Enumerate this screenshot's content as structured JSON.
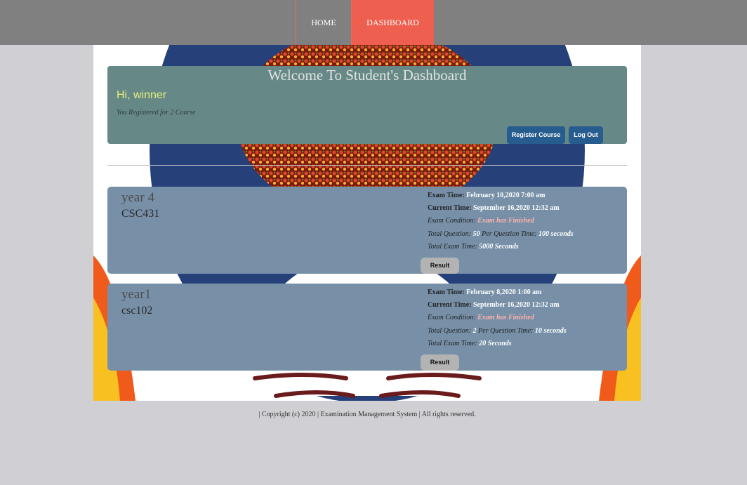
{
  "nav": {
    "home_label": "HOME",
    "dashboard_label": "DASHBOARD"
  },
  "welcome": {
    "title": "Welcome To Student's Dashboard",
    "greeting": "Hi, winner",
    "registered_text": "You Registered for 2 Course",
    "register_button": "Register Course",
    "logout_button": "Log Out"
  },
  "labels": {
    "exam_time": "Exam Time:",
    "current_time": "Current Time:",
    "exam_condition": "Exam Condition:",
    "total_question": "Total Question:",
    "per_question_time": "Per Question Time:",
    "total_exam_time": "Total Exam Time:",
    "result_button": "Result"
  },
  "exams": [
    {
      "year": "year 4",
      "course": "CSC431",
      "exam_time": "February 10,2020 7:00 am",
      "current_time": "September 16,2020 12:32 am",
      "condition": "Exam has Finished",
      "total_question": "50",
      "per_question_time": "100 seconds",
      "total_exam_time": "5000 Seconds"
    },
    {
      "year": "year1",
      "course": "csc102",
      "exam_time": "February 8,2020 1:00 am",
      "current_time": "September 16,2020 12:32 am",
      "condition": "Exam has Finished",
      "total_question": "2",
      "per_question_time": "10 seconds",
      "total_exam_time": "20 Seconds"
    }
  ],
  "footer": {
    "text": "| Copyright (c) 2020 | Examination Management System | All rights reserved."
  },
  "colors": {
    "nav_bar": "#808080",
    "nav_active": "#ee5f4f",
    "welcome_panel": "#668987",
    "exam_card": "#7790a8",
    "button_blue": "#275c8f"
  }
}
